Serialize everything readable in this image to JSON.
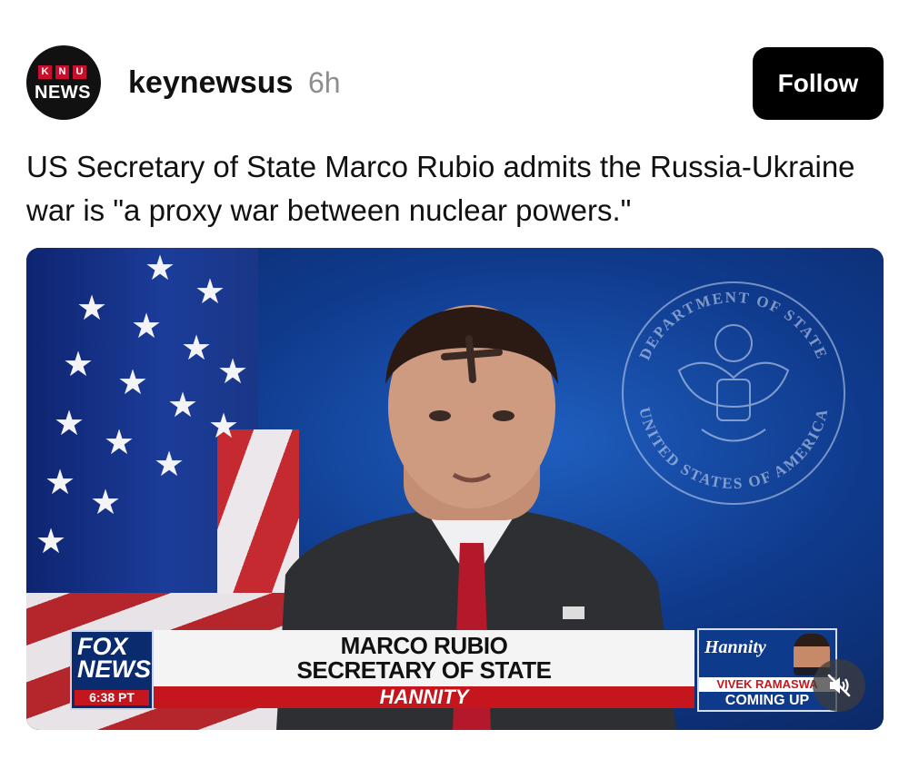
{
  "post": {
    "avatar": {
      "letters": [
        "K",
        "N",
        "U"
      ],
      "word": "NEWS"
    },
    "username": "keynewsus",
    "time": "6h",
    "follow_label": "Follow",
    "caption": "US Secretary of State Marco Rubio admits the Russia-Ukraine war is \"a proxy war between nuclear powers.\""
  },
  "video": {
    "network_logo": {
      "line1": "FOX",
      "line2": "NEWS",
      "time": "6:38 PT"
    },
    "lower_third": {
      "name": "MARCO RUBIO",
      "title": "SECRETARY OF STATE",
      "show": "HANNITY"
    },
    "promo": {
      "show": "Hannity",
      "guest": "VIVEK RAMASWA",
      "cta": "COMING UP"
    },
    "seal_text": {
      "top": "DEPARTMENT OF STATE",
      "bottom": "UNITED STATES OF AMERICA"
    },
    "icons": {
      "mute": "speaker-muted-icon"
    }
  },
  "colors": {
    "follow_bg": "#000000",
    "fox_red": "#c4161c",
    "fox_blue": "#0a2b6e"
  }
}
